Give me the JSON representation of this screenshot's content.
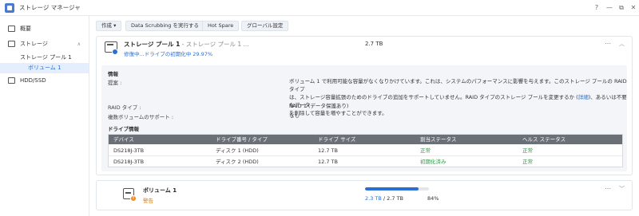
{
  "app": {
    "title": "ストレージ マネージャ"
  },
  "window_controls": {
    "help": "?",
    "minimize": "—",
    "restore": "⧉",
    "close": "✕"
  },
  "sidebar": {
    "items": [
      {
        "label": "概要"
      },
      {
        "label": "ストレージ"
      },
      {
        "label": "ストレージ プール 1"
      },
      {
        "label": "ボリューム 1"
      },
      {
        "label": "HDD/SSD"
      }
    ]
  },
  "toolbar": {
    "create_label": "作成 ▾",
    "scrubbing_label": "Data Scrubbing を実行する",
    "hotspare_label": "Hot Spare",
    "global_settings_label": "グローバル設定"
  },
  "pool": {
    "name": "ストレージ プール 1",
    "subtitle": " - ストレージ プール 1 ...",
    "status": "修復中...ドライブの初期化中 29.97%",
    "size": "2.7 TB",
    "info_title": "情報",
    "suggestion_label": "提案 :",
    "suggestion_line1": "ボリューム 1 で利用可能な容量がなくなりかけています。これは、システムのパフォーマンスに影響を与えます。このストレージ プールの RAID タイプ",
    "suggestion_line2a": "は、ストレージ容量拡張のためのドライブの追加をサポートしていません。RAID タイプのストレージ プールを変更するか (",
    "suggestion_link": "詳細",
    "suggestion_line2b": ")、あるいは不要なデータ",
    "suggestion_line3": "を削除して容量を増やすことができます。",
    "raid_label": "RAID タイプ :",
    "raid_value": "RAID 1 (データ保護あり)",
    "multi_vol_label": "複数ボリュームのサポート :",
    "multi_vol_value": "なし",
    "drive_info_title": "ドライブ情報"
  },
  "drive_table": {
    "headers": [
      "デバイス",
      "ドライブ番号 / タイプ",
      "ドライブ サイズ",
      "割当ステータス",
      "ヘルス ステータス"
    ],
    "rows": [
      [
        "DS218J-3TB",
        "ディスク 1 (HDD)",
        "12.7 TB",
        "正常",
        "正常"
      ],
      [
        "DS218J-3TB",
        "ディスク 2 (HDD)",
        "12.7 TB",
        "初期化済み",
        "正常"
      ]
    ]
  },
  "volume": {
    "name": "ボリューム 1",
    "status": "警告",
    "badge": "!",
    "used": "2.3 TB",
    "total": " / 2.7 TB",
    "percent_label": "84%",
    "usage_fraction": 0.84
  },
  "icons": {
    "more": "⋯",
    "chevron_up": "︿",
    "chevron_down": "﹀",
    "sidebar_chevron": "∧"
  },
  "colors": {
    "accent": "#2a6fd6",
    "ok": "#2e9a44",
    "warning": "#e07b00"
  }
}
